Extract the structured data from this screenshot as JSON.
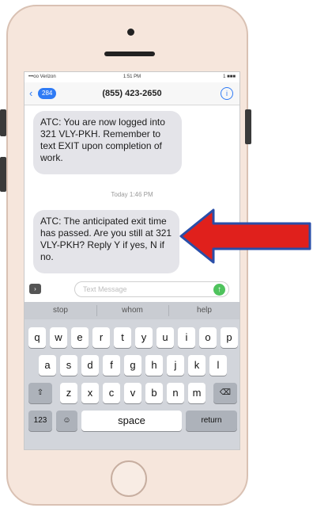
{
  "status_bar": {
    "carrier": "•••oo Verizon",
    "time": "1:51 PM",
    "battery": "1 ■■■"
  },
  "nav": {
    "back_count": "284",
    "title": "(855) 423-2650",
    "info_glyph": "i"
  },
  "messages": [
    {
      "text": "ATC: You are now logged into 321  VLY-PKH.  Remember to text EXIT upon completion of work."
    },
    {
      "text": "ATC: The anticipated exit time has passed.  Are you still at 321  VLY-PKH?  Reply Y if yes, N if no."
    }
  ],
  "timestamp": "Today 1:46 PM",
  "compose": {
    "placeholder": "Text Message"
  },
  "suggestions": [
    "stop",
    "whom",
    "help"
  ],
  "keyboard": {
    "row1": [
      "q",
      "w",
      "e",
      "r",
      "t",
      "y",
      "u",
      "i",
      "o",
      "p"
    ],
    "row2": [
      "a",
      "s",
      "d",
      "f",
      "g",
      "h",
      "j",
      "k",
      "l"
    ],
    "row3": [
      "z",
      "x",
      "c",
      "v",
      "b",
      "n",
      "m"
    ],
    "numbers_key": "123",
    "space_key": "space",
    "return_key": "return"
  },
  "colors": {
    "accent": "#2f7bf5",
    "arrow_fill": "#e0201c",
    "arrow_border": "#2a4ea8",
    "send": "#4fc35d"
  }
}
